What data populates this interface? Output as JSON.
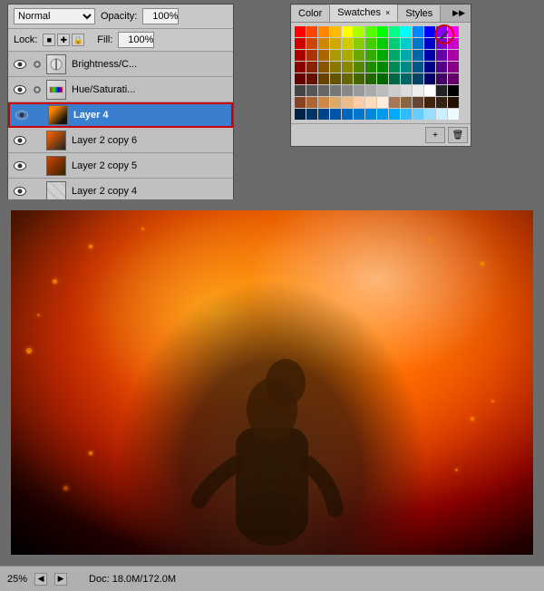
{
  "layers_panel": {
    "blend_mode": "Normal",
    "opacity_label": "Opacity:",
    "opacity_value": "100%",
    "lock_label": "Lock:",
    "fill_label": "Fill:",
    "fill_value": "100%",
    "layers": [
      {
        "id": "brightness",
        "name": "Brightness/C...",
        "type": "adjustment",
        "visible": true,
        "linked": true
      },
      {
        "id": "hue",
        "name": "Hue/Saturati...",
        "type": "adjustment",
        "visible": true,
        "linked": true
      },
      {
        "id": "layer4",
        "name": "Layer 4",
        "type": "photo",
        "visible": true,
        "linked": false,
        "active": true
      },
      {
        "id": "copy6",
        "name": "Layer 2 copy 6",
        "type": "photo",
        "visible": true,
        "linked": false
      },
      {
        "id": "copy5",
        "name": "Layer 2 copy 5",
        "type": "photo",
        "visible": true,
        "linked": false
      },
      {
        "id": "copy4",
        "name": "Layer 2 copy 4",
        "type": "photo",
        "visible": true,
        "linked": false
      }
    ]
  },
  "swatches_panel": {
    "tabs": [
      {
        "id": "color",
        "label": "Color",
        "active": false,
        "closeable": false
      },
      {
        "id": "swatches",
        "label": "Swatches",
        "active": true,
        "closeable": true
      },
      {
        "id": "styles",
        "label": "Styles",
        "active": false,
        "closeable": false
      }
    ],
    "swatches": [
      "#ff0000",
      "#ff4400",
      "#ff8800",
      "#ffbb00",
      "#ffff00",
      "#aaff00",
      "#55ff00",
      "#00ff00",
      "#00ff88",
      "#00ffff",
      "#0088ff",
      "#0000ff",
      "#8800ff",
      "#ff00ff",
      "#cc0000",
      "#cc4400",
      "#cc8800",
      "#ccaa00",
      "#cccc00",
      "#88cc00",
      "#44cc00",
      "#00cc00",
      "#00cc77",
      "#00cccc",
      "#0077cc",
      "#0000cc",
      "#7700cc",
      "#cc00cc",
      "#aa0000",
      "#aa3300",
      "#aa6600",
      "#aa9900",
      "#aaaa00",
      "#66aa00",
      "#33aa00",
      "#00aa00",
      "#00aa66",
      "#00aaaa",
      "#0066aa",
      "#0000aa",
      "#6600aa",
      "#aa00aa",
      "#880000",
      "#882200",
      "#885500",
      "#887700",
      "#888800",
      "#558800",
      "#228800",
      "#008800",
      "#008855",
      "#008888",
      "#005588",
      "#000088",
      "#550088",
      "#880088",
      "#660000",
      "#661100",
      "#664400",
      "#665500",
      "#666600",
      "#446600",
      "#226600",
      "#006600",
      "#006644",
      "#006666",
      "#004466",
      "#000066",
      "#440066",
      "#660066",
      "#444444",
      "#555555",
      "#666666",
      "#777777",
      "#888888",
      "#999999",
      "#aaaaaa",
      "#bbbbbb",
      "#cccccc",
      "#dddddd",
      "#eeeeee",
      "#ffffff",
      "#222222",
      "#000000",
      "#884422",
      "#aa6633",
      "#cc8844",
      "#ddaa66",
      "#eebb88",
      "#ffccaa",
      "#ffddbB",
      "#ffeedd",
      "#aa7755",
      "#886644",
      "#664433",
      "#442211",
      "#332211",
      "#221100",
      "#002244",
      "#003366",
      "#004488",
      "#0055aa",
      "#0066bb",
      "#0077cc",
      "#0088dd",
      "#0099ee",
      "#00aaff",
      "#33bbff",
      "#66ccff",
      "#99ddff",
      "#cceeFF",
      "#eef8ff"
    ]
  },
  "canvas": {
    "zoom": "25%",
    "doc_info": "Doc: 18.0M/172.0M"
  }
}
